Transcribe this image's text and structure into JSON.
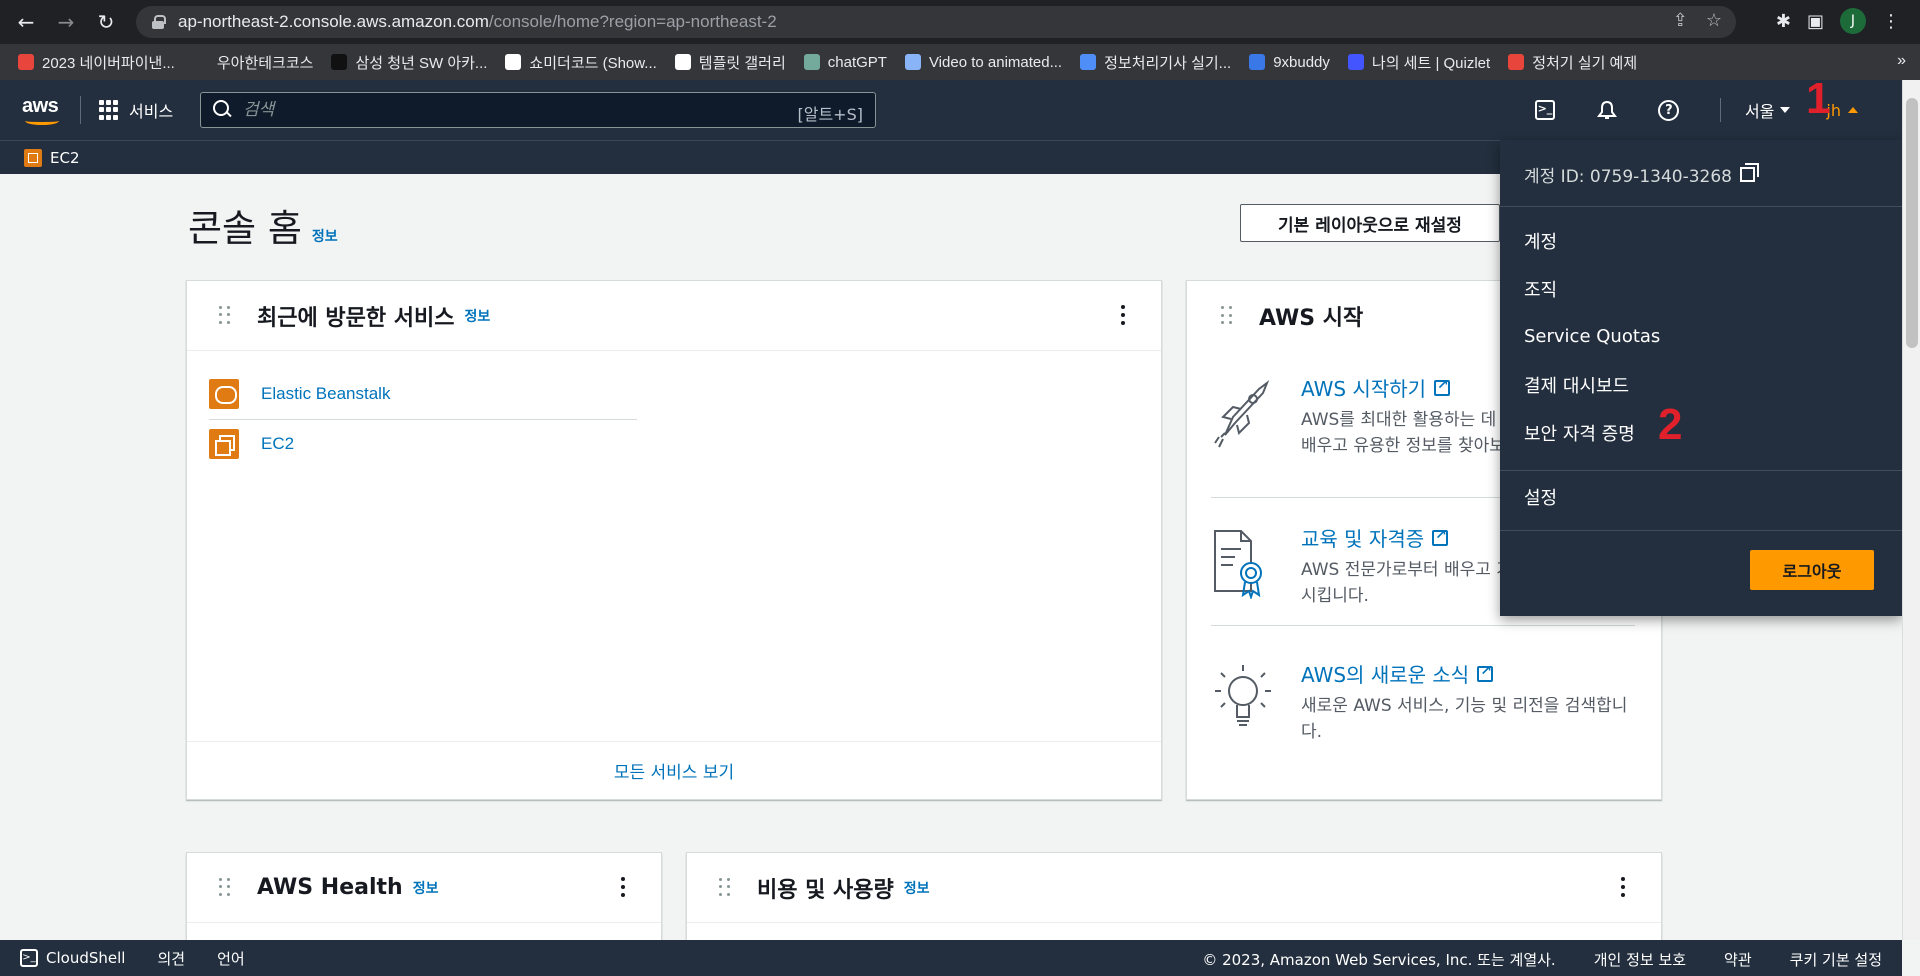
{
  "browser": {
    "url_host": "ap-northeast-2.console.aws.amazon.com",
    "url_path": "/console/home?region=ap-northeast-2",
    "profile_initial": "J",
    "bookmarks": [
      {
        "label": "2023 네이버파이낸...",
        "color": "#e8453c"
      },
      {
        "label": "우아한테크코스",
        "color": "#35363a"
      },
      {
        "label": "삼성 청년 SW 아카...",
        "color": "#111111"
      },
      {
        "label": "쇼미더코드 (Show...",
        "color": "#ffffff"
      },
      {
        "label": "템플릿 갤러리",
        "color": "#ffffff"
      },
      {
        "label": "chatGPT",
        "color": "#74aa9c"
      },
      {
        "label": "Video to animated...",
        "color": "#8ab4f8"
      },
      {
        "label": "정보처리기사 실기...",
        "color": "#4f8ef7"
      },
      {
        "label": "9xbuddy",
        "color": "#3b78e7"
      },
      {
        "label": "나의 세트 | Quizlet",
        "color": "#4255ff"
      },
      {
        "label": "정처기 실기 예제",
        "color": "#e8453c"
      }
    ]
  },
  "header": {
    "logo_text": "aws",
    "services_label": "서비스",
    "search_placeholder": "검색",
    "search_hint": "[알트+S]",
    "region": "서울",
    "user": "jh",
    "favorite": "EC2"
  },
  "annotations": {
    "one": "1",
    "two": "2"
  },
  "main": {
    "title": "콘솔 홈",
    "title_info": "정보",
    "reset_button": "기본 레이아웃으로 재설정"
  },
  "recent": {
    "title": "최근에 방문한 서비스",
    "info": "정보",
    "items": [
      "Elastic Beanstalk",
      "EC2"
    ],
    "footer": "모든 서비스 보기"
  },
  "start": {
    "title": "AWS 시작",
    "items": [
      {
        "link": "AWS 시작하기",
        "desc": "AWS를 최대한 활용하는 데 필요한 기초 지식을 배우고 유용한 정보를 찾아보세요."
      },
      {
        "link": "교육 및 자격증",
        "desc": "AWS 전문가로부터 배우고 기술과 지식을 발전시킵니다."
      },
      {
        "link": "AWS의 새로운 소식",
        "desc": "새로운 AWS 서비스, 기능 및 리전을 검색합니다."
      }
    ]
  },
  "health": {
    "title": "AWS Health",
    "info": "정보"
  },
  "cost": {
    "title": "비용 및 사용량",
    "info": "정보"
  },
  "dropdown": {
    "account_id": "계정 ID: 0759-1340-3268",
    "items": [
      "계정",
      "조직",
      "Service Quotas",
      "결제 대시보드",
      "보안 자격 증명"
    ],
    "settings": "설정",
    "logout": "로그아웃"
  },
  "footer": {
    "cloudshell": "CloudShell",
    "feedback": "의견",
    "language": "언어",
    "copyright": "© 2023, Amazon Web Services, Inc. 또는 계열사.",
    "privacy": "개인 정보 보호",
    "terms": "약관",
    "cookies": "쿠키 기본 설정"
  }
}
